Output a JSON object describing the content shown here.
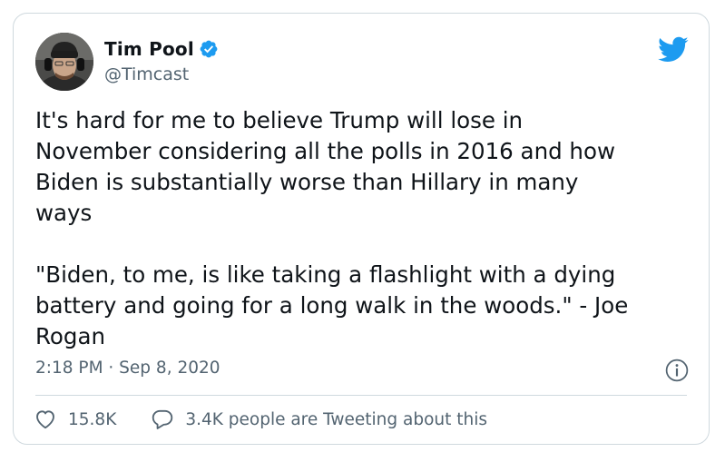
{
  "author": {
    "name": "Tim Pool",
    "handle": "@Timcast",
    "verified": true
  },
  "tweet": {
    "text": "It's hard for me to believe Trump will lose in\nNovember considering all the polls in 2016 and how\nBiden is substantially worse than Hillary in many\nways\n\n\"Biden, to me, is like taking a flashlight with a dying\nbattery and going for a long walk in the woods.\" - Joe\nRogan",
    "timestamp": "2:18 PM · Sep 8, 2020"
  },
  "actions": {
    "likes": "15.8K",
    "discussion": "3.4K people are Tweeting about this"
  },
  "colors": {
    "twitter_blue": "#1d9bf0",
    "secondary_text": "#536471",
    "border": "#cfd9de"
  },
  "icons": [
    "verified-badge-icon",
    "twitter-bird-icon",
    "info-icon",
    "heart-icon",
    "speech-bubble-icon"
  ]
}
